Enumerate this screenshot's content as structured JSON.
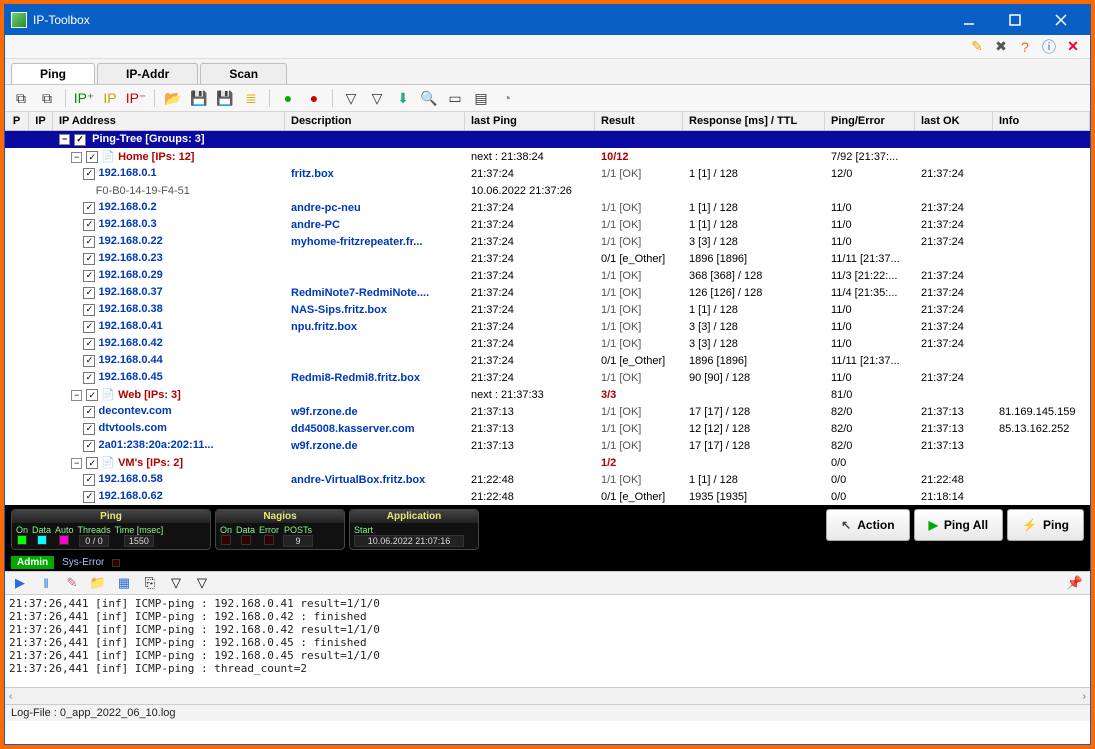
{
  "window": {
    "title": "IP-Toolbox"
  },
  "tabs": {
    "ping": "Ping",
    "ipaddr": "IP-Addr",
    "scan": "Scan"
  },
  "columns": {
    "p": "P",
    "ip": "IP",
    "addr": "IP Address",
    "desc": "Description",
    "last": "last Ping",
    "result": "Result",
    "rms": "Response [ms] / TTL",
    "pe": "Ping/Error",
    "lok": "last OK",
    "info": "Info"
  },
  "tree_root": "Ping-Tree [Groups: 3]",
  "groups": [
    {
      "label": "Home [IPs: 12]",
      "last": "next : 21:38:24",
      "result": "10/12",
      "pe": "7/92 [21:37:...",
      "rows": [
        {
          "dot": "green",
          "addr": "192.168.0.1",
          "desc": "fritz.box",
          "last": "21:37:24",
          "result": "1/1 [OK]",
          "rms": "1 [1] / 128",
          "pe": "12/0",
          "lok": "21:37:24",
          "sub": "F0-B0-14-19-F4-51",
          "sublast": "10.06.2022 21:37:26"
        },
        {
          "dot": "green",
          "addr": "192.168.0.2",
          "desc": "andre-pc-neu",
          "last": "21:37:24",
          "result": "1/1 [OK]",
          "rms": "1 [1] / 128",
          "pe": "11/0",
          "lok": "21:37:24"
        },
        {
          "dot": "green",
          "addr": "192.168.0.3",
          "desc": "andre-PC",
          "last": "21:37:24",
          "result": "1/1 [OK]",
          "rms": "1 [1] / 128",
          "pe": "11/0",
          "lok": "21:37:24"
        },
        {
          "dot": "green",
          "addr": "192.168.0.22",
          "desc": "myhome-fritzrepeater.fr...",
          "last": "21:37:24",
          "result": "1/1 [OK]",
          "rms": "3 [3] / 128",
          "pe": "11/0",
          "lok": "21:37:24"
        },
        {
          "dot": "pink",
          "addr": "192.168.0.23",
          "desc": "",
          "last": "21:37:24",
          "result": "0/1 [e_Other]",
          "rms": "1896 [1896]",
          "pe": "11/11 [21:37...",
          "lok": ""
        },
        {
          "dot": "green",
          "addr": "192.168.0.29",
          "desc": "",
          "last": "21:37:24",
          "result": "1/1 [OK]",
          "rms": "368 [368] / 128",
          "pe": "11/3 [21:22:...",
          "lok": "21:37:24"
        },
        {
          "dot": "green",
          "addr": "192.168.0.37",
          "desc": "RedmiNote7-RedmiNote....",
          "last": "21:37:24",
          "result": "1/1 [OK]",
          "rms": "126 [126] / 128",
          "pe": "11/4 [21:35:...",
          "lok": "21:37:24"
        },
        {
          "dot": "green",
          "addr": "192.168.0.38",
          "desc": "NAS-Sips.fritz.box",
          "last": "21:37:24",
          "result": "1/1 [OK]",
          "rms": "1 [1] / 128",
          "pe": "11/0",
          "lok": "21:37:24"
        },
        {
          "dot": "green",
          "addr": "192.168.0.41",
          "desc": "npu.fritz.box",
          "last": "21:37:24",
          "result": "1/1 [OK]",
          "rms": "3 [3] / 128",
          "pe": "11/0",
          "lok": "21:37:24"
        },
        {
          "dot": "green",
          "addr": "192.168.0.42",
          "desc": "",
          "last": "21:37:24",
          "result": "1/1 [OK]",
          "rms": "3 [3] / 128",
          "pe": "11/0",
          "lok": "21:37:24"
        },
        {
          "dot": "pink",
          "addr": "192.168.0.44",
          "desc": "",
          "last": "21:37:24",
          "result": "0/1 [e_Other]",
          "rms": "1896 [1896]",
          "pe": "11/11 [21:37...",
          "lok": ""
        },
        {
          "dot": "green",
          "addr": "192.168.0.45",
          "desc": "Redmi8-Redmi8.fritz.box",
          "last": "21:37:24",
          "result": "1/1 [OK]",
          "rms": "90 [90] / 128",
          "pe": "11/0",
          "lok": "21:37:24"
        }
      ]
    },
    {
      "label": "Web [IPs: 3]",
      "last": "next : 21:37:33",
      "result": "3/3",
      "pe": "81/0",
      "rows": [
        {
          "dot": "green",
          "addr": "decontev.com",
          "desc": "w9f.rzone.de",
          "last": "21:37:13",
          "result": "1/1 [OK]",
          "rms": "17 [17] / 128",
          "pe": "82/0",
          "lok": "21:37:13",
          "info": "81.169.145.159"
        },
        {
          "dot": "green",
          "addr": "dtvtools.com",
          "desc": "dd45008.kasserver.com",
          "last": "21:37:13",
          "result": "1/1 [OK]",
          "rms": "12 [12] / 128",
          "pe": "82/0",
          "lok": "21:37:13",
          "info": "85.13.162.252"
        },
        {
          "dot": "green",
          "addr": "2a01:238:20a:202:11...",
          "desc": "w9f.rzone.de",
          "last": "21:37:13",
          "result": "1/1 [OK]",
          "rms": "17 [17] / 128",
          "pe": "82/0",
          "lok": "21:37:13"
        }
      ]
    },
    {
      "label": "VM's [IPs: 2]",
      "last": "",
      "result": "1/2",
      "pe": "0/0",
      "rows": [
        {
          "dot": "green",
          "addr": "192.168.0.58",
          "desc": "andre-VirtualBox.fritz.box",
          "last": "21:22:48",
          "result": "1/1 [OK]",
          "rms": "1 [1] / 128",
          "pe": "0/0",
          "lok": "21:22:48"
        },
        {
          "dot": "red",
          "addr": "192.168.0.62",
          "desc": "",
          "last": "21:22:48",
          "result": "0/1 [e_Other]",
          "rms": "1935 [1935]",
          "pe": "0/0",
          "lok": "21:18:14"
        }
      ]
    }
  ],
  "status": {
    "ping": {
      "title": "Ping",
      "labels": {
        "on": "On",
        "data": "Data",
        "auto": "Auto",
        "threads": "Threads",
        "time": "Time [msec]"
      },
      "threads_val": "0 / 0",
      "time_val": "1550"
    },
    "nagios": {
      "title": "Nagios",
      "labels": {
        "on": "On",
        "data": "Data",
        "error": "Error",
        "posts": "POSTs"
      },
      "posts_val": "9"
    },
    "app": {
      "title": "Application",
      "label": "Start",
      "val": "10.06.2022 21:07:16"
    }
  },
  "buttons": {
    "action": "Action",
    "pingall": "Ping All",
    "ping": "Ping"
  },
  "adminbar": {
    "admin": "Admin",
    "syserr": "Sys-Error"
  },
  "log": "21:37:26,441 [inf] ICMP-ping : 192.168.0.41 result=1/1/0\n21:37:26,441 [inf] ICMP-ping : 192.168.0.42 : finished\n21:37:26,441 [inf] ICMP-ping : 192.168.0.42 result=1/1/0\n21:37:26,441 [inf] ICMP-ping : 192.168.0.45 : finished\n21:37:26,441 [inf] ICMP-ping : 192.168.0.45 result=1/1/0\n21:37:26,441 [inf] ICMP-ping : thread_count=2",
  "footer": "Log-File : 0_app_2022_06_10.log"
}
